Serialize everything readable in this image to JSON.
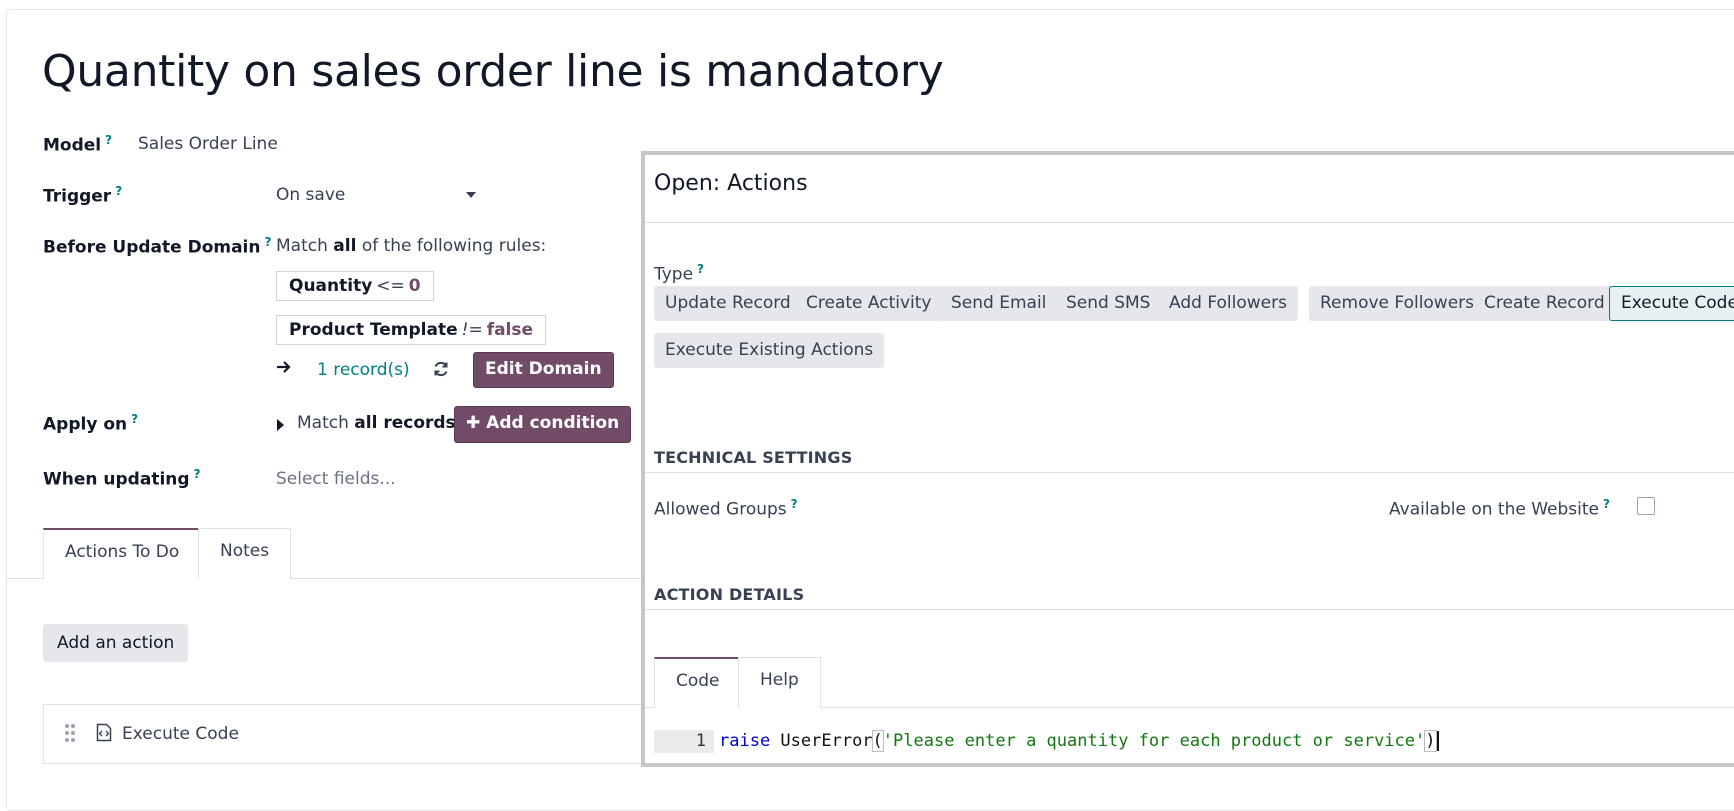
{
  "record": {
    "title": "Quantity on sales order line is mandatory",
    "model_label": "Model",
    "model_value": "Sales Order Line",
    "trigger_label": "Trigger",
    "trigger_value": "On save",
    "domain_label": "Before Update Domain",
    "domain_intro_prefix": "Match ",
    "domain_intro_all": "all",
    "domain_intro_suffix": " of the following rules:",
    "rules": [
      {
        "field": "Quantity",
        "op": "<=",
        "value": "0"
      },
      {
        "field": "Product Template",
        "op": "!=",
        "value": "false"
      }
    ],
    "records_link": "1 record(s)",
    "edit_domain_button": "Edit Domain",
    "apply_on_label": "Apply on",
    "apply_match_prefix": "Match ",
    "apply_match_all": "all records",
    "add_condition_button": "Add condition",
    "when_updating_label": "When updating",
    "when_updating_placeholder": "Select fields...",
    "tabs": [
      "Actions To Do",
      "Notes"
    ],
    "add_action_button": "Add an action",
    "action_row_label": "Execute Code",
    "help_mark": "?"
  },
  "dialog": {
    "title": "Open: Actions",
    "type_label": "Type",
    "type_options": [
      "Update Record",
      "Create Activity",
      "Send Email",
      "Send SMS",
      "Add Followers",
      "Remove Followers",
      "Create Record",
      "Execute Code",
      "Execute Existing Actions"
    ],
    "type_selected": "Execute Code",
    "technical_settings": "TECHNICAL SETTINGS",
    "allowed_groups_label": "Allowed Groups",
    "available_website_label": "Available on the Website",
    "action_details": "ACTION DETAILS",
    "code_tabs": [
      "Code",
      "Help"
    ],
    "code": {
      "line_number": "1",
      "keyword": "raise",
      "func": " UserError",
      "open": "(",
      "string": "'Please enter a quantity for each product or service'",
      "close": ")"
    }
  },
  "colors": {
    "brand": "#714b67",
    "accent": "#017e84"
  }
}
